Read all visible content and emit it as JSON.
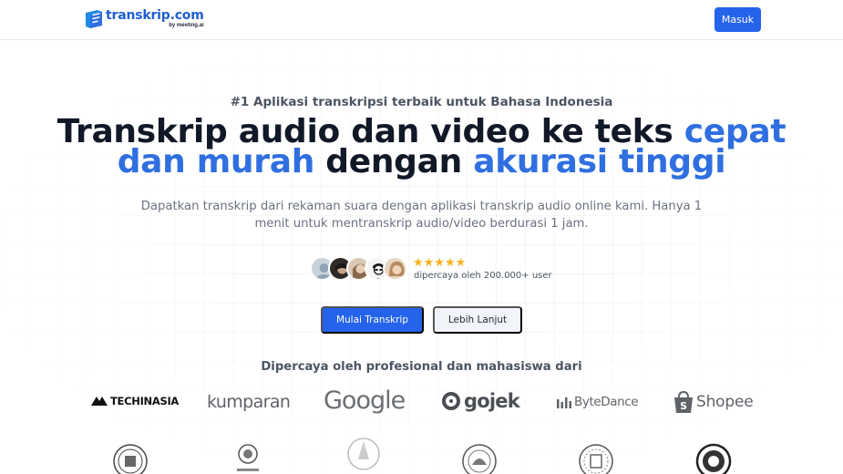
{
  "header": {
    "logo_name": "transkrip.com",
    "logo_sub": "by meeting.ai",
    "login_label": "Masuk"
  },
  "hero": {
    "eyebrow": "#1 Aplikasi transkripsi terbaik untuk Bahasa Indonesia",
    "headline_part1": "Transkrip audio dan video ke teks ",
    "headline_hl1": "cepat",
    "headline_hl2": "dan murah",
    "headline_part2": " dengan ",
    "headline_hl3": "akurasi tinggi",
    "subtext": "Dapatkan transkrip dari rekaman suara dengan aplikasi transkrip audio online kami. Hanya 1 menit untuk mentranskrip audio/video berdurasi 1 jam.",
    "rating_stars": "★★★★★",
    "rating": 5,
    "trusted_by_users": "dipercaya oleh 200.000+ user",
    "primary_cta": "Mulai Transkrip",
    "secondary_cta": "Lebih Lanjut"
  },
  "trusted": {
    "title": "Dipercaya oleh profesional dan mahasiswa dari",
    "brands": [
      "TECHINASIA",
      "kumparan",
      "Google",
      "gojek",
      "ByteDance",
      "Shopee"
    ],
    "university_seals": 6
  },
  "colors": {
    "primary": "#2563eb",
    "highlight": "#2f6fe0",
    "star": "#f5b21b"
  }
}
